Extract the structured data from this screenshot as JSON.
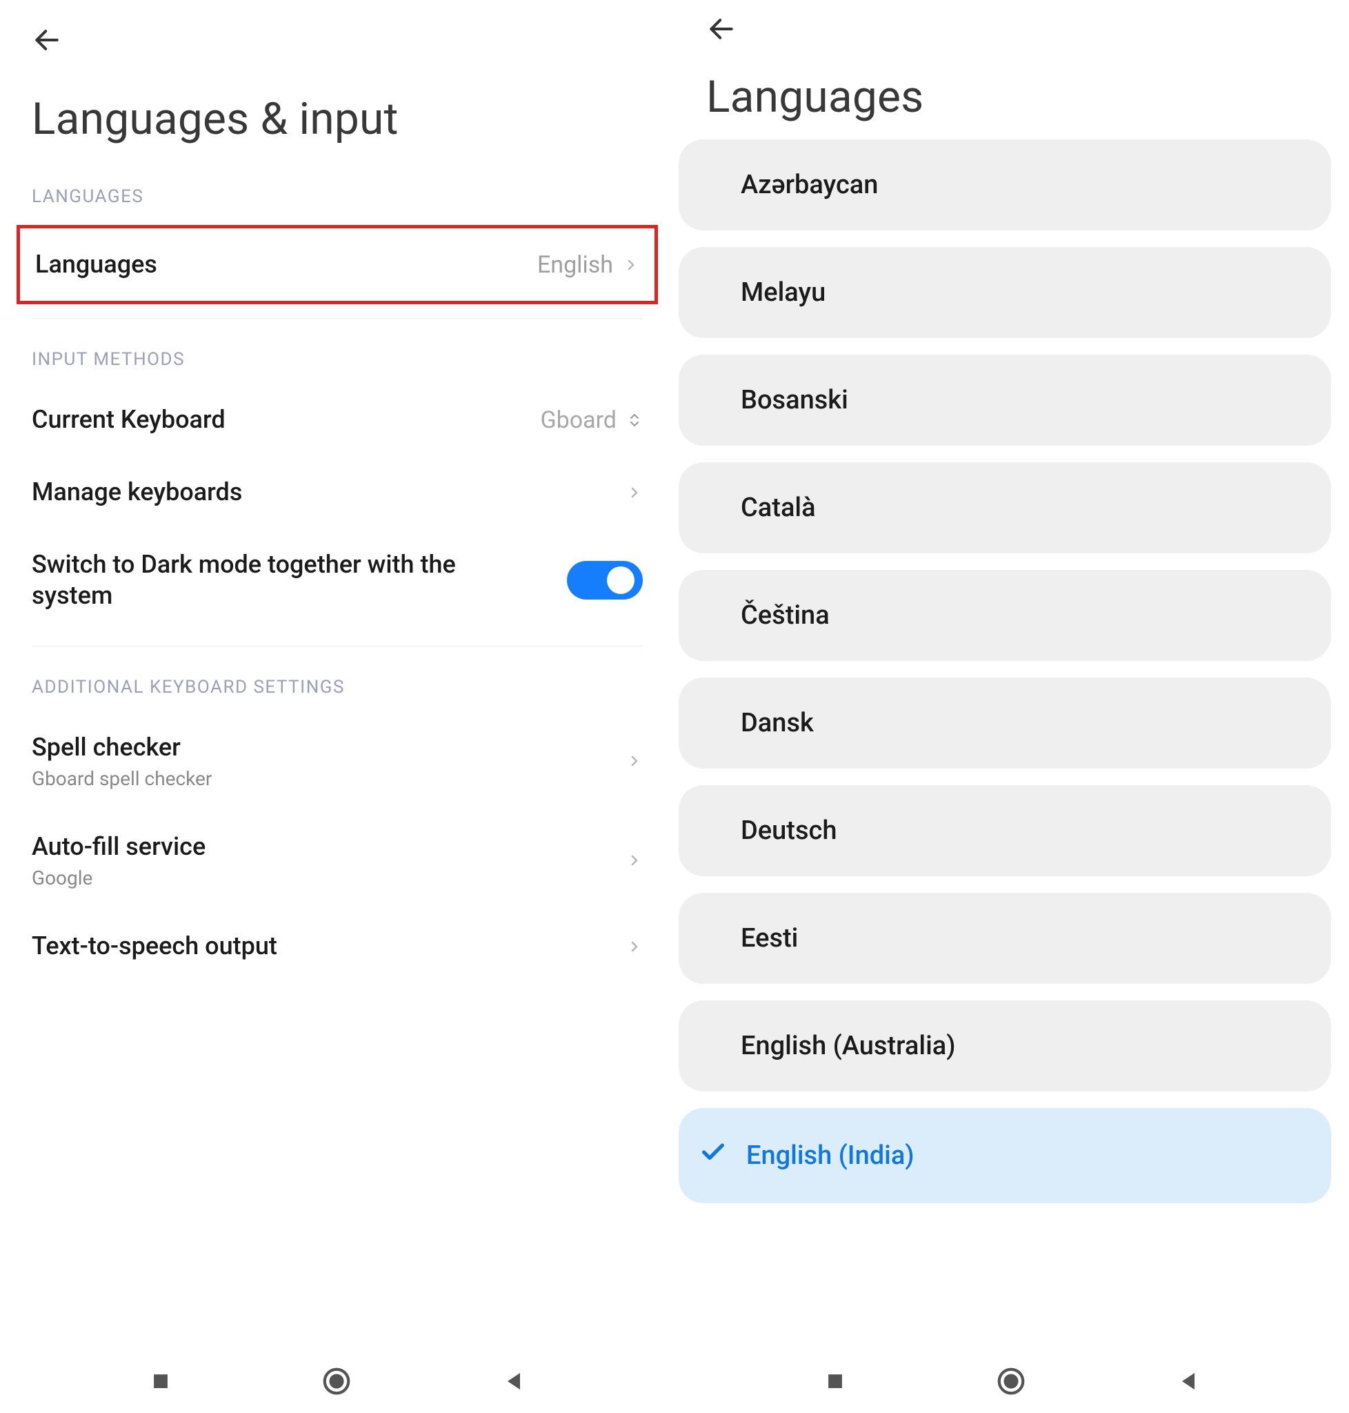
{
  "left": {
    "title": "Languages & input",
    "sections": {
      "languages": {
        "header": "LANGUAGES",
        "languages_row": {
          "label": "Languages",
          "value": "English"
        }
      },
      "input_methods": {
        "header": "INPUT METHODS",
        "current_keyboard": {
          "label": "Current Keyboard",
          "value": "Gboard"
        },
        "manage_keyboards": {
          "label": "Manage keyboards"
        },
        "dark_mode": {
          "label": "Switch to Dark mode together with the system",
          "on": true
        }
      },
      "additional": {
        "header": "ADDITIONAL KEYBOARD SETTINGS",
        "spell_checker": {
          "label": "Spell checker",
          "sub": "Gboard spell checker"
        },
        "autofill": {
          "label": "Auto-fill service",
          "sub": "Google"
        },
        "tts": {
          "label": "Text-to-speech output"
        }
      }
    }
  },
  "right": {
    "title": "Languages",
    "items": [
      {
        "name": "Azərbaycan",
        "selected": false
      },
      {
        "name": "Melayu",
        "selected": false
      },
      {
        "name": "Bosanski",
        "selected": false
      },
      {
        "name": "Català",
        "selected": false
      },
      {
        "name": "Čeština",
        "selected": false
      },
      {
        "name": "Dansk",
        "selected": false
      },
      {
        "name": "Deutsch",
        "selected": false
      },
      {
        "name": "Eesti",
        "selected": false
      },
      {
        "name": "English (Australia)",
        "selected": false
      },
      {
        "name": "English (India)",
        "selected": true
      }
    ]
  }
}
